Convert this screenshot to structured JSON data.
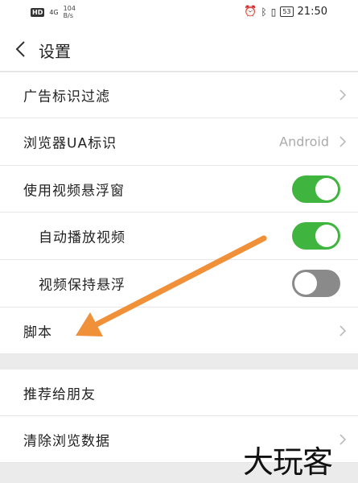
{
  "status_bar": {
    "hd": "HD",
    "signal": "4G",
    "speed": "104",
    "speed_unit": "B/s",
    "time": "21:50",
    "battery": "53"
  },
  "header": {
    "title": "设置"
  },
  "rows": [
    {
      "label": "广告标识过滤"
    },
    {
      "label": "浏览器UA标识",
      "value": "Android"
    },
    {
      "label": "使用视频悬浮窗",
      "toggle": true
    },
    {
      "label": "自动播放视频",
      "toggle": true
    },
    {
      "label": "视频保持悬浮",
      "toggle": false
    },
    {
      "label": "脚本"
    },
    {
      "label": "推荐给朋友"
    },
    {
      "label": "清除浏览数据"
    }
  ],
  "watermark": "大玩客",
  "colors": {
    "toggle_on": "#3fb43f",
    "toggle_off": "#8a8a8a",
    "arrow": "#f0913a"
  }
}
